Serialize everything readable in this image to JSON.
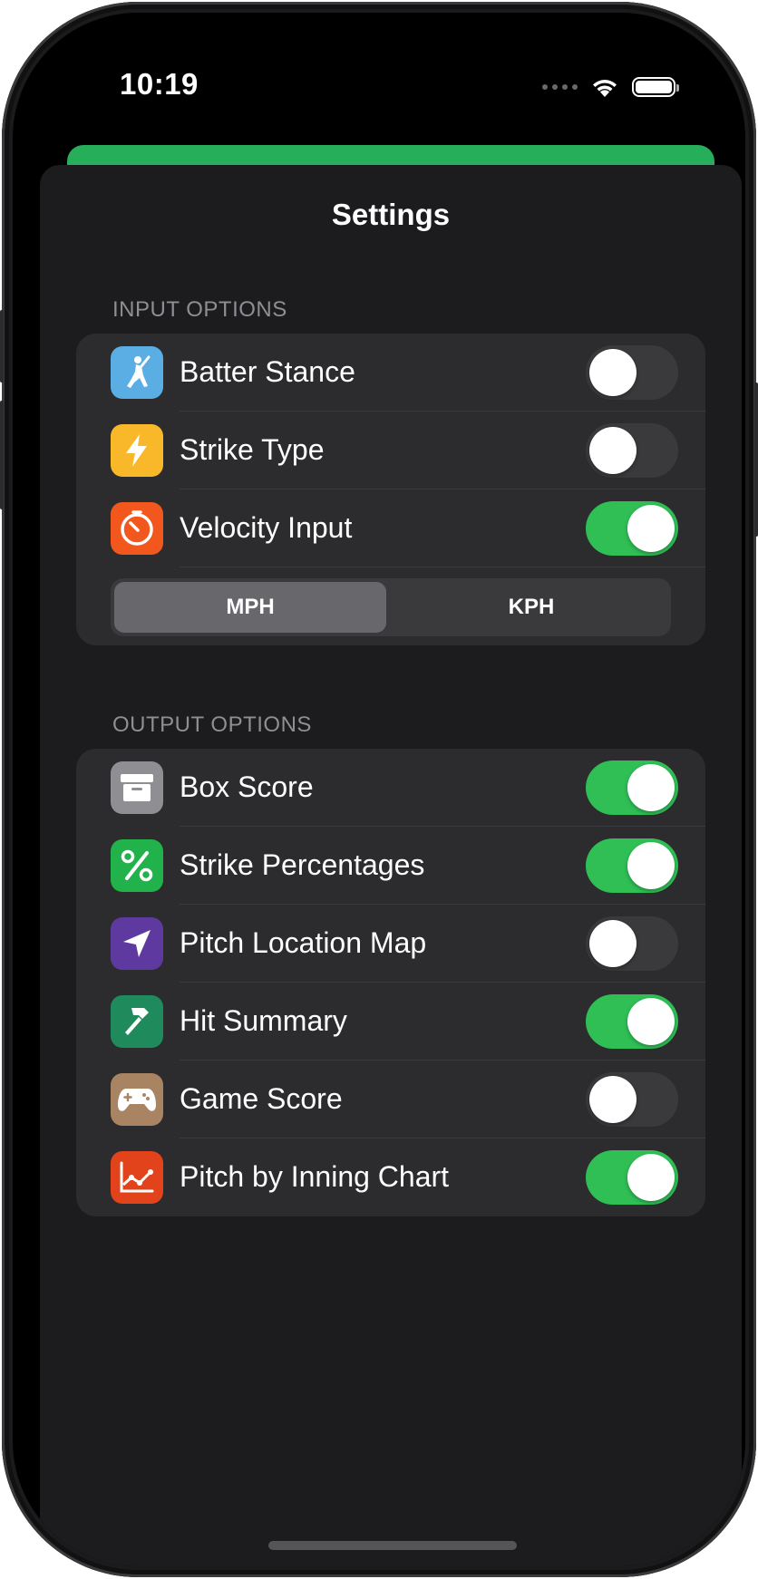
{
  "status_bar": {
    "time": "10:19"
  },
  "sheet": {
    "title": "Settings"
  },
  "input_options": {
    "header": "INPUT OPTIONS",
    "rows": [
      {
        "label": "Batter Stance",
        "icon": "batter-icon",
        "icon_color": "#5aaee3",
        "on": false
      },
      {
        "label": "Strike Type",
        "icon": "lightning-icon",
        "icon_color": "#f9b82a",
        "on": false
      },
      {
        "label": "Velocity Input",
        "icon": "speedometer-icon",
        "icon_color": "#f2571d",
        "on": true
      }
    ],
    "units": {
      "options": [
        "MPH",
        "KPH"
      ],
      "selected": "MPH"
    }
  },
  "output_options": {
    "header": "OUTPUT OPTIONS",
    "rows": [
      {
        "label": "Box Score",
        "icon": "archive-box-icon",
        "icon_color": "#8e8e93",
        "on": true
      },
      {
        "label": "Strike Percentages",
        "icon": "percent-icon",
        "icon_color": "#21b24c",
        "on": true
      },
      {
        "label": "Pitch Location Map",
        "icon": "location-arrow-icon",
        "icon_color": "#5e3aa0",
        "on": false
      },
      {
        "label": "Hit Summary",
        "icon": "hammer-icon",
        "icon_color": "#1f8a5c",
        "on": true
      },
      {
        "label": "Game Score",
        "icon": "gamepad-icon",
        "icon_color": "#a88462",
        "on": false
      },
      {
        "label": "Pitch by Inning Chart",
        "icon": "line-chart-icon",
        "icon_color": "#e2431b",
        "on": true
      }
    ]
  },
  "colors": {
    "toggle_on": "#2fbf55",
    "toggle_off": "#3a3a3d",
    "accent_strip": "#27ae5a"
  }
}
